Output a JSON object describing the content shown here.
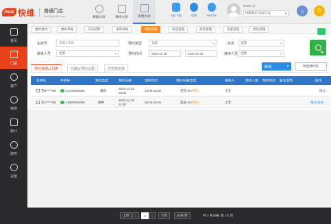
{
  "brand": {
    "mark": "ONCE",
    "name": "快维",
    "store": "普通门店",
    "store_sub": "www.cqkuaiwei.com"
  },
  "top_nav": [
    {
      "label": "数据大屏",
      "icon": "chart-icon"
    },
    {
      "label": "维修大屏",
      "icon": "repair-icon"
    },
    {
      "label": "管理大屏",
      "icon": "manage-icon"
    }
  ],
  "quick": [
    {
      "label": "App下载",
      "icon": "phone-icon",
      "color": "#3a9bf0"
    },
    {
      "label": "商城",
      "icon": "shop-icon",
      "color": "#2e8be6"
    },
    {
      "label": "WeChat",
      "icon": "wechat-icon",
      "color": "#3a9bf0"
    }
  ],
  "user": {
    "name": "Kevin.Ji",
    "shop": "快维测试门店1号 店",
    "caret": "▾"
  },
  "colors": {
    "brand": "#e8411c",
    "table_header": "#2f76c8",
    "active_tab": "#ff8c1a",
    "search": "#33b24a"
  },
  "sidebar": [
    {
      "label": "首页",
      "icon": "home-icon",
      "active": false
    },
    {
      "label": "门店",
      "icon": "store-icon",
      "active": true
    },
    {
      "label": "客户",
      "icon": "customer-icon",
      "active": false
    },
    {
      "label": "维修",
      "icon": "repair-icon",
      "active": false
    },
    {
      "label": "统计",
      "icon": "stats-icon",
      "active": false
    },
    {
      "label": "财务",
      "icon": "finance-icon",
      "active": false
    },
    {
      "label": "设置",
      "icon": "settings-icon",
      "active": false
    }
  ],
  "subtabs": [
    "维修接待",
    "维修单据",
    "交车结算",
    "采购单据",
    "预约管理",
    "商品管理",
    "库存管理",
    "车型管理",
    "保险管理"
  ],
  "filters": {
    "plate_label": "车牌号",
    "plate_placeholder": "请输入车牌",
    "type_label": "预约类型",
    "type_value": "全部",
    "status_label": "状态",
    "status_value": "全部",
    "phone_label": "联系人号",
    "phone_value": "全部",
    "date_label": "预约时间",
    "date_from": "2020-12-29",
    "date_to": "2021-01-02",
    "person_label": "接待人员",
    "person_value": "全部"
  },
  "list_tabs": [
    "预约待确认列表",
    "已确认预约记录",
    "已完成记录"
  ],
  "actions": {
    "primary": "新增",
    "secondary": "导出预约表"
  },
  "table": {
    "headers": [
      "车牌号",
      "手机号",
      "预约类型",
      "预约日期",
      "预约时间",
      "预约车辆/类型",
      "接待人",
      "预约人数",
      "预约时间",
      "备注说明",
      "操作"
    ],
    "rows": [
      {
        "plate": "京B*****88",
        "phone": "13700000000",
        "type": "维修",
        "date": "2020-12-31",
        "time": "10:30",
        "slot": "14:00-15:00",
        "vehicle": "宝马 X5",
        "vehicle_tag": "(预约)",
        "receiver": "小王",
        "action": "确认"
      },
      {
        "plate": "京A*****66",
        "phone": "13800000000",
        "type": "保养",
        "date": "2020-12-31",
        "time": "11:00",
        "slot": "15:00-16:00",
        "vehicle": "奥迪 A6",
        "vehicle_tag": "(预约)",
        "receiver": "小李",
        "action": "确认/取消"
      }
    ]
  },
  "pager": {
    "prev": "上页",
    "page": "1",
    "next": "下页",
    "per_page": "20条/页",
    "summary": "共 2 条记录, 第 1/1 页"
  }
}
